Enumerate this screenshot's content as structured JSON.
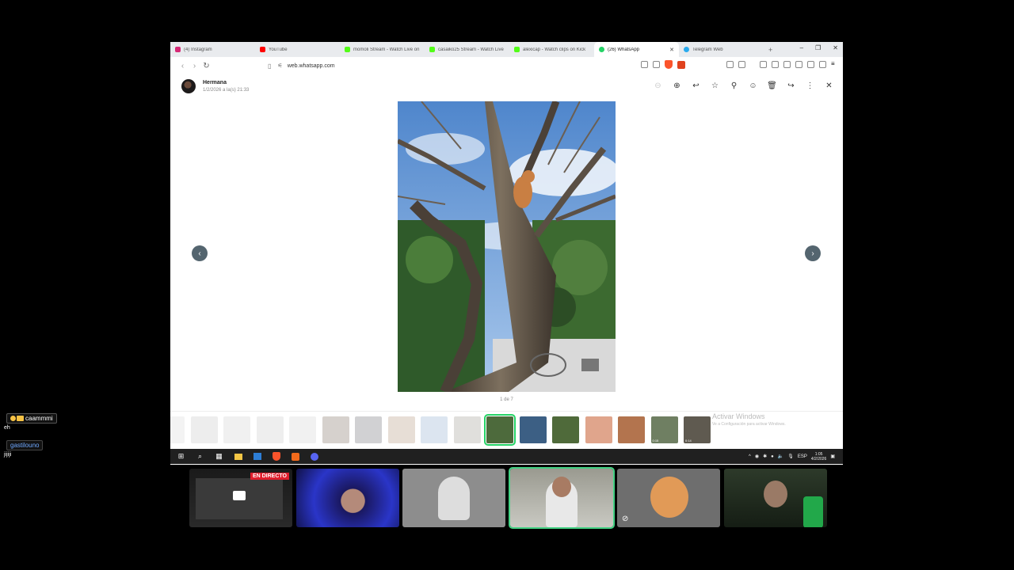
{
  "browser": {
    "tabs": [
      {
        "label": "(4) Instagram",
        "color": "#d62976"
      },
      {
        "label": "YouTube",
        "color": "#ff0000"
      },
      {
        "label": "momoli Stream - Watch Live on",
        "color": "#53fc18"
      },
      {
        "label": "casaiko25 Stream - Watch Live",
        "color": "#53fc18"
      },
      {
        "label": "alexicap - Watch clips on Kick",
        "color": "#53fc18"
      },
      {
        "label": "(26) WhatsApp",
        "color": "#25d366",
        "active": true
      },
      {
        "label": "Telegram Web",
        "color": "#2aabee"
      }
    ],
    "new_tab": "+",
    "url": "web.whatsapp.com"
  },
  "viewer": {
    "sender_name": "Hermana",
    "sender_time": "1/2/2026 a la(s) 21:33",
    "counter": "1 de 7",
    "prev": "‹",
    "next": "›"
  },
  "thumbnails": [
    {
      "color": "#ddd",
      "faded": true
    },
    {
      "color": "#ccc",
      "faded": true
    },
    {
      "color": "#d4d4d4",
      "faded": true
    },
    {
      "color": "#cfcfcf",
      "faded": true
    },
    {
      "color": "#d8d8d8",
      "faded": true
    },
    {
      "color": "#8a7b70",
      "faded": true
    },
    {
      "color": "#7c7c80",
      "faded": true
    },
    {
      "color": "#b9a08a",
      "faded": true
    },
    {
      "color": "#9cb5d3",
      "faded": true
    },
    {
      "color": "#a7a29a",
      "faded": true
    },
    {
      "color": "#4d6a3c",
      "selected": true
    },
    {
      "color": "#3c5f84"
    },
    {
      "color": "#4f6a3a"
    },
    {
      "color": "#e0a58c"
    },
    {
      "color": "#b3744e"
    },
    {
      "color": "#6f7f62",
      "duration": "0:15"
    },
    {
      "color": "#5f5a50",
      "duration": "0:14"
    }
  ],
  "windows_watermark": {
    "title": "Activar Windows",
    "subtitle": "Ve a Configuración para activar Windows."
  },
  "taskbar": {
    "tray_chevron": "^",
    "language": "ESP",
    "time": "1:05",
    "date": "4/2/2026"
  },
  "chat": [
    {
      "user": "caammmi",
      "message": "eh"
    },
    {
      "user": "gastilouno",
      "message": "jijiji"
    }
  ],
  "stream": {
    "live_label": "EN DIRECTO"
  }
}
